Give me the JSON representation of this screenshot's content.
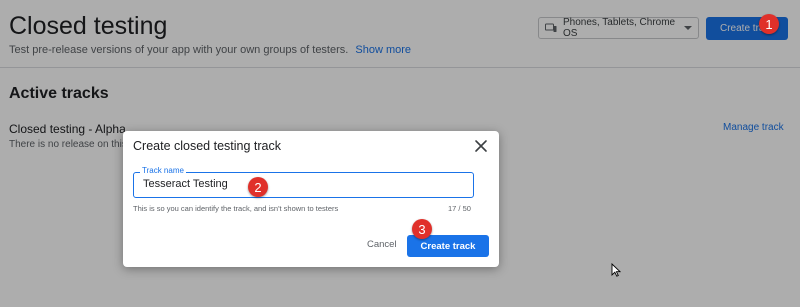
{
  "page": {
    "title": "Closed testing",
    "subtitle": "Test pre-release versions of your app with your own groups of testers.",
    "show_more": "Show more",
    "device_selector": "Phones, Tablets, Chrome OS",
    "create_track_button": "Create track"
  },
  "active_tracks": {
    "heading": "Active tracks",
    "tracks": [
      {
        "name": "Closed testing - Alpha",
        "status": "There is no release on this track",
        "manage": "Manage track"
      }
    ]
  },
  "dialog": {
    "title": "Create closed testing track",
    "field_label": "Track name",
    "field_value": "Tesseract Testing",
    "helper": "This is so you can identify the track, and isn't shown to testers",
    "counter": "17 / 50",
    "cancel": "Cancel",
    "create": "Create track"
  },
  "annotations": {
    "step1": "1",
    "step2": "2",
    "step3": "3"
  },
  "colors": {
    "accent": "#1a73e8",
    "step_badge": "#e0302a"
  },
  "icons": {
    "device": "devices-icon",
    "dropdown": "chevron-down-icon",
    "close": "close-icon",
    "cursor": "mouse-cursor-icon"
  }
}
